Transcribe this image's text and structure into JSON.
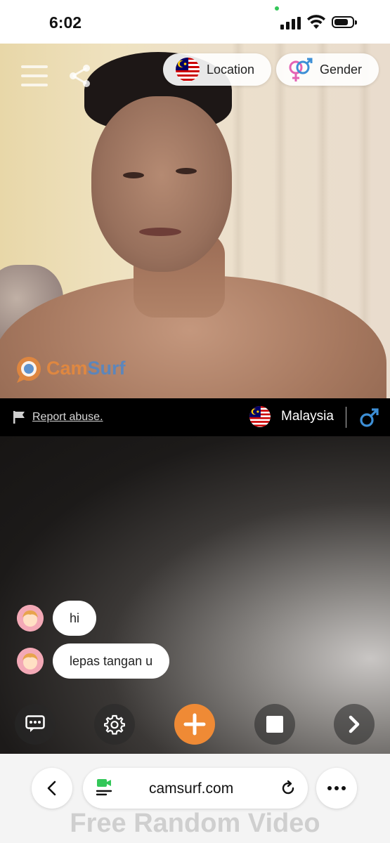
{
  "status_bar": {
    "time": "6:02"
  },
  "top_controls": {
    "location_label": "Location",
    "gender_label": "Gender"
  },
  "watermark": {
    "brand_part1": "Cam",
    "brand_part2": "Surf"
  },
  "info_bar": {
    "report_label": "Report abuse.",
    "country": "Malaysia"
  },
  "chat": {
    "messages": [
      {
        "text": "hi"
      },
      {
        "text": "lepas tangan u"
      }
    ]
  },
  "browser": {
    "url": "camsurf.com",
    "page_heading_partial": "Free Random Video"
  },
  "colors": {
    "accent_orange": "#ef8a35",
    "brand_blue": "#4f87c9",
    "male_blue": "#3d8fd6",
    "female_pink": "#e463b4"
  },
  "icons": [
    "menu-icon",
    "share-icon",
    "malaysia-flag-icon",
    "gender-icon",
    "flag-icon",
    "male-icon",
    "chat-icon",
    "settings-icon",
    "add-icon",
    "stop-icon",
    "next-icon",
    "back-icon",
    "facetime-icon",
    "reload-icon",
    "more-icon"
  ]
}
